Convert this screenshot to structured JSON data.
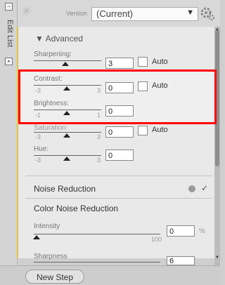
{
  "sidebar": {
    "label": "Edit List",
    "top_box": "−",
    "bottom_box": "▪"
  },
  "header": {
    "version_label": "Version",
    "version_value": "(Current)",
    "dropdown_arrow": "▼",
    "gear_icon": "gear-icon"
  },
  "advanced": {
    "title": "Advanced",
    "sharpening": {
      "label": "Sharpening:",
      "value": "3",
      "auto": "Auto"
    },
    "contrast": {
      "label": "Contrast:",
      "min": "-3",
      "max": "3",
      "value": "0",
      "auto": "Auto"
    },
    "brightness": {
      "label": "Brightness:",
      "min": "-1",
      "max": "1",
      "value": "0"
    },
    "saturation": {
      "label": "Saturation:",
      "min": "-3",
      "max": "3",
      "value": "0",
      "auto": "Auto"
    },
    "hue": {
      "label": "Hue:",
      "min": "-3",
      "max": "3",
      "value": "0"
    }
  },
  "noise_reduction": {
    "title": "Noise Reduction",
    "check": "✓"
  },
  "color_noise": {
    "title": "Color Noise Reduction",
    "intensity": {
      "label": "Intensity",
      "max": "100",
      "value": "0",
      "unit": "%"
    },
    "sharpness": {
      "label": "Sharpness",
      "value": "6"
    }
  },
  "footer": {
    "new_step": "New Step"
  },
  "colors": {
    "accent": "#e0c640",
    "highlight": "#ff0000"
  }
}
